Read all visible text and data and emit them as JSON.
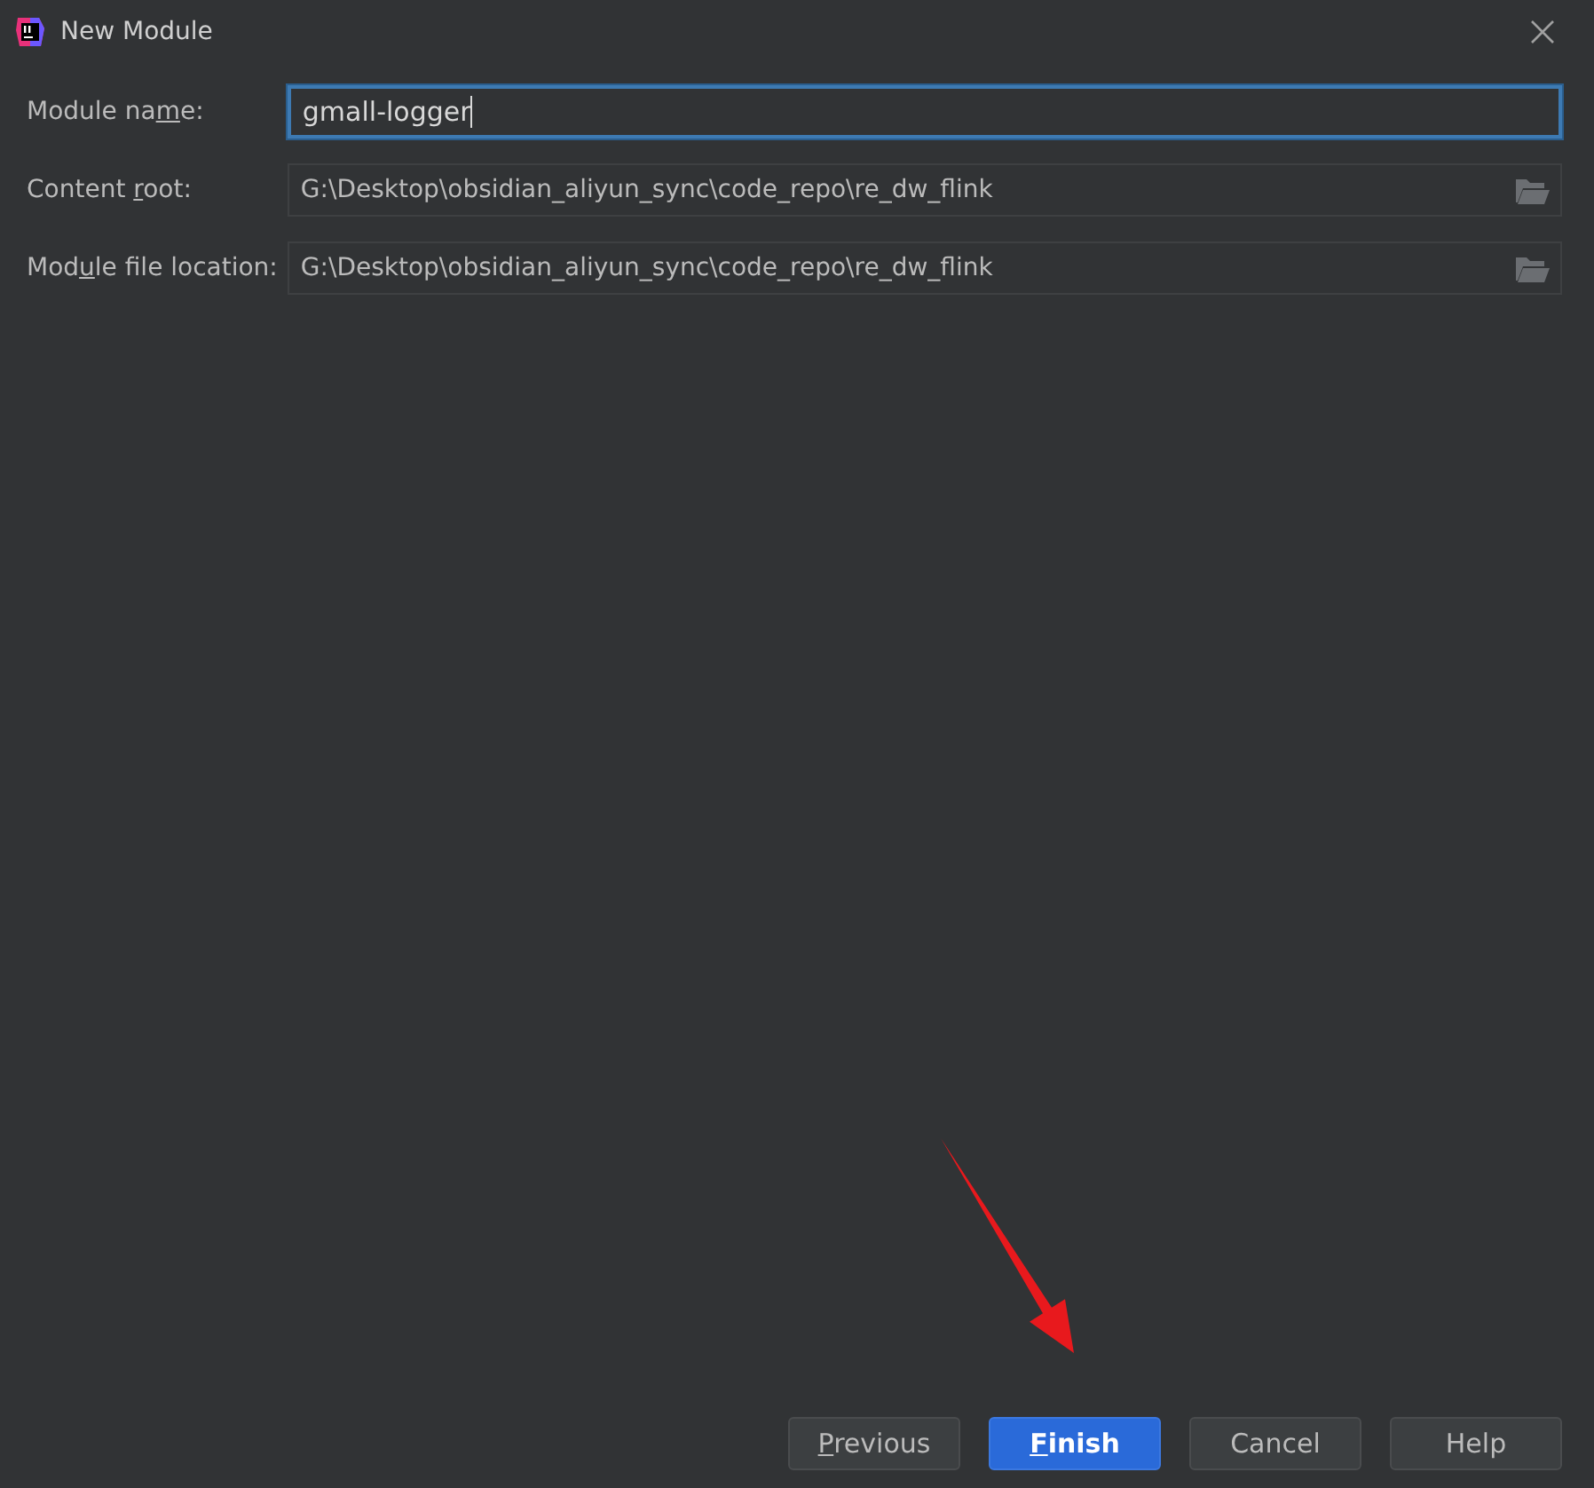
{
  "window": {
    "title": "New Module"
  },
  "fields": [
    {
      "label": {
        "before": "Module na",
        "key": "m",
        "after": "e:"
      },
      "value": "gmall-logger",
      "focused": true,
      "browse": false
    },
    {
      "label": {
        "before": "Content ",
        "key": "r",
        "after": "oot:"
      },
      "value": "G:\\Desktop\\obsidian_aliyun_sync\\code_repo\\re_dw_flink",
      "focused": false,
      "browse": true
    },
    {
      "label": {
        "before": "Mod",
        "key": "u",
        "after": "le file location:"
      },
      "value": "G:\\Desktop\\obsidian_aliyun_sync\\code_repo\\re_dw_flink",
      "focused": false,
      "browse": true
    }
  ],
  "buttons": [
    {
      "label": {
        "key": "P",
        "after": "revious"
      },
      "default": false
    },
    {
      "label": {
        "key": "F",
        "after": "inish"
      },
      "default": true
    },
    {
      "label": {
        "before": "Cancel"
      },
      "default": false
    },
    {
      "label": {
        "before": "Help"
      },
      "default": false
    }
  ],
  "annotation": {
    "kind": "arrow"
  }
}
